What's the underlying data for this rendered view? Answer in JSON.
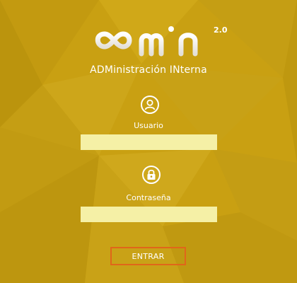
{
  "brand": {
    "logo_text": "admin",
    "version": "2.0",
    "subtitle": "ADMinistración INterna"
  },
  "login_form": {
    "username": {
      "label": "Usuario",
      "value": "",
      "icon": "user-icon"
    },
    "password": {
      "label": "Contraseña",
      "value": "",
      "icon": "lock-icon"
    },
    "submit_label": "ENTRAR"
  },
  "colors": {
    "background": "#c9a012",
    "input_fill": "#f5f0a6",
    "button_border": "#e0661a",
    "text": "#ffffff"
  }
}
